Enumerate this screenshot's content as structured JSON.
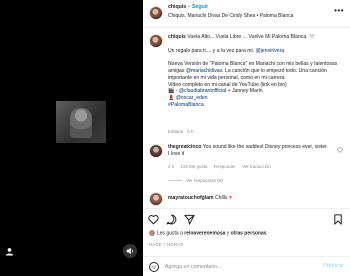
{
  "header": {
    "username": "chiquis",
    "follow_label": "Seguir",
    "audio": "Chiquis, Mariachi Divas De Cindy Shea • Paloma Blanca",
    "more": "•••"
  },
  "caption": {
    "username": "chiquis",
    "line1": "Vuela Alto... Vuela Libre ... Vuelve Mi Paloma Blanca. 🕊️",
    "line2_prefix": "Un regalo para ti.... y a la vez para mi. ",
    "line2_mention": "@jennirivera",
    "line3": "Nueva Versión de “Paloma Blanca” en Mariachi con mis bellas y talentosas amigas ",
    "line3_mention": "@mariachidivas",
    "line3_suffix": ". La canción que lo empezó todo. Una canción importante en mi vida personal, como en mi carrera.",
    "line4": "Video completo en mi canal de YouTube (link en bio)",
    "line5_prefix": "🎬 - ",
    "line5_mention": "@claudiabrantofficial",
    "line5_suffix": " + Janney Marin",
    "line6_prefix": "💄 ",
    "line6_mention": "@oscar_eden",
    "hashtag": "#PalomaBlanca",
    "edited": "Editado · 5 h"
  },
  "comment": {
    "username": "thegreatcinco",
    "text": "You sound like the saddest Disney princess ever, sister. I love it",
    "time": "4 h",
    "likes": "119 Me gusta",
    "reply": "Responder",
    "translate": "Ver traducción"
  },
  "replies_label": "Ver respuestas (5)",
  "comment2": {
    "username": "mayratouchofglam",
    "text": "Chills"
  },
  "likes": {
    "prefix": "Les gusta a ",
    "user": "reinaverenemosa",
    "middle": " y ",
    "others": "otras personas"
  },
  "date": "HACE 7 HORAS",
  "comment_box": {
    "placeholder": "Agrega un comentario...",
    "publish_label": "Publicar"
  }
}
